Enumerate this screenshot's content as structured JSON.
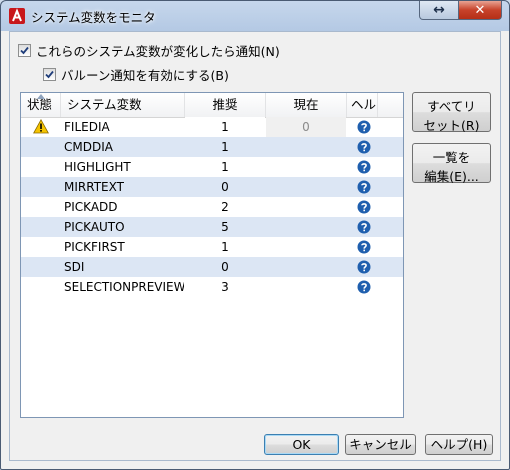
{
  "window": {
    "title": "システム変数をモニタ",
    "controls": {
      "resize_glyph": "↔",
      "close_glyph": "✕"
    }
  },
  "options": {
    "notify_label": "これらのシステム変数が変化したら通知(N)",
    "notify_checked": true,
    "balloon_label": "バルーン通知を有効にする(B)",
    "balloon_checked": true
  },
  "table": {
    "columns": {
      "status": "状態",
      "variable": "システム変数",
      "preferred": "推奨",
      "current": "現在",
      "help": "ヘルプ"
    },
    "rows": [
      {
        "name": "FILEDIA",
        "preferred": "1",
        "current": "0",
        "status_icon": "warning-icon"
      },
      {
        "name": "CMDDIA",
        "preferred": "1",
        "current": ""
      },
      {
        "name": "HIGHLIGHT",
        "preferred": "1",
        "current": ""
      },
      {
        "name": "MIRRTEXT",
        "preferred": "0",
        "current": ""
      },
      {
        "name": "PICKADD",
        "preferred": "2",
        "current": ""
      },
      {
        "name": "PICKAUTO",
        "preferred": "5",
        "current": ""
      },
      {
        "name": "PICKFIRST",
        "preferred": "1",
        "current": ""
      },
      {
        "name": "SDI",
        "preferred": "0",
        "current": ""
      },
      {
        "name": "SELECTIONPREVIEW",
        "preferred": "3",
        "current": ""
      }
    ]
  },
  "side_buttons": {
    "reset_line1": "すべてリ",
    "reset_line2": "セット(R)",
    "edit_line1": "一覧を",
    "edit_line2": "編集(E)..."
  },
  "footer": {
    "ok": "OK",
    "cancel": "キャンセル",
    "help": "ヘルプ(H)"
  },
  "colors": {
    "alt_row": "#dce6f4",
    "help_icon": "#1f5fae",
    "warning": "#f5c400",
    "close_button": "#c7422a"
  }
}
